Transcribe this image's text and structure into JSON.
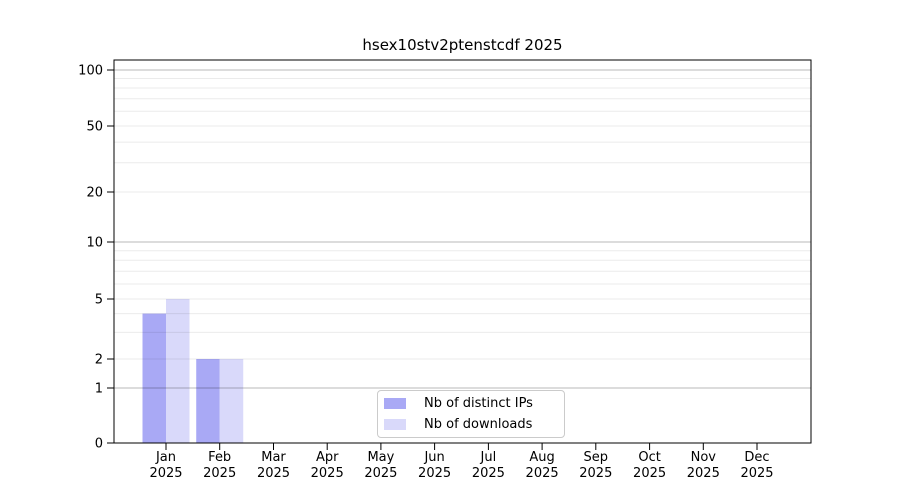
{
  "chart_data": {
    "type": "bar",
    "title": "hsex10stv2ptenstcdf 2025",
    "categories": [
      "Jan",
      "Feb",
      "Mar",
      "Apr",
      "May",
      "Jun",
      "Jul",
      "Aug",
      "Sep",
      "Oct",
      "Nov",
      "Dec"
    ],
    "x_year_label": "2025",
    "series": [
      {
        "name": "Nb of distinct IPs",
        "color": "#a9a9f5",
        "values": [
          4,
          2,
          0,
          0,
          0,
          0,
          0,
          0,
          0,
          0,
          0,
          0
        ]
      },
      {
        "name": "Nb of downloads",
        "color": "#d9d9fa",
        "values": [
          5,
          2,
          0,
          0,
          0,
          0,
          0,
          0,
          0,
          0,
          0,
          0
        ]
      }
    ],
    "y_ticks": [
      0,
      1,
      2,
      5,
      10,
      20,
      50,
      100
    ],
    "y_minor_gridlines": [
      3,
      4,
      6,
      7,
      8,
      9,
      30,
      40,
      60,
      70,
      80,
      90
    ],
    "y_major_gridlines": [
      1,
      10,
      100
    ],
    "y_scale": "symlog",
    "ylim": [
      0,
      100
    ],
    "grid": "horizontal",
    "legend_position": "lower center"
  }
}
